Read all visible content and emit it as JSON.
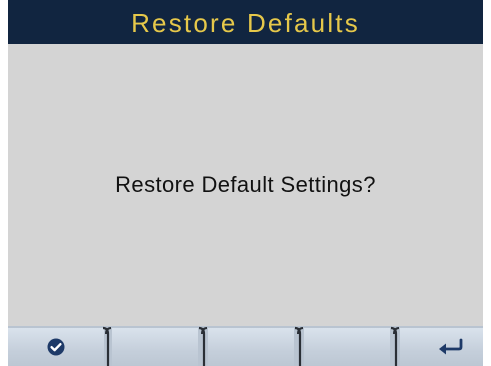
{
  "header": {
    "title": "Restore Defaults"
  },
  "dialog": {
    "prompt": "Restore Default Settings?"
  },
  "softkeys": [
    {
      "icon": "checkmark-circle-icon"
    },
    {
      "icon": ""
    },
    {
      "icon": ""
    },
    {
      "icon": ""
    },
    {
      "icon": "back-arrow-icon"
    }
  ],
  "colors": {
    "title_bar": "#112540",
    "title_text": "#e6c84a",
    "screen_bg": "#d4d4d4",
    "softkey_bar": "#b9c4d1",
    "icon_color": "#1e3a68"
  }
}
